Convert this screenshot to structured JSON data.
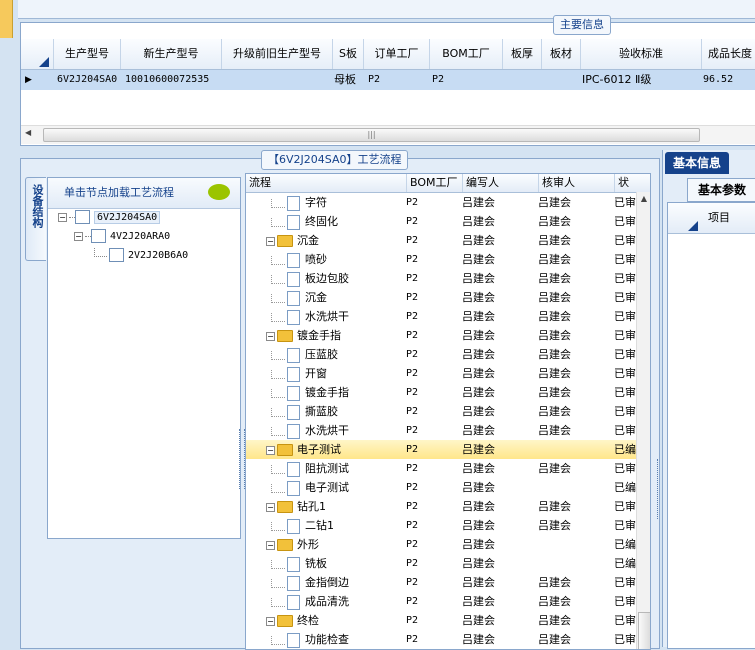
{
  "main_info": {
    "tab_label": "主要信息",
    "columns": [
      "生产型号",
      "新生产型号",
      "升级前旧生产型号",
      "S板",
      "订单工厂",
      "BOM工厂",
      "板厚",
      "板材",
      "验收标准",
      "成品长度"
    ],
    "row": {
      "production_model": "6V2J204SA0",
      "new_production_model": "10010600072535",
      "old_production_model": "",
      "s_board": "母板",
      "order_factory": "P2",
      "bom_factory": "P2",
      "thickness": "",
      "material": "",
      "acceptance_standard": "IPC-6012 Ⅱ级",
      "finished_length": "96.52"
    }
  },
  "process_panel": {
    "tab_label": "【6V2J204SA0】工艺流程",
    "side_tab_label": "设备结构",
    "tree_header": "单击节点加载工艺流程",
    "tree": [
      "6V2J204SA0",
      "4V2J20ARA0",
      "2V2J20B6A0"
    ],
    "grid": {
      "columns": [
        "流程",
        "BOM工厂",
        "编写人",
        "核审人",
        "状态"
      ],
      "rows": [
        {
          "name": "字符",
          "type": "step",
          "bom": "P2",
          "writer": "吕建会",
          "reviewer": "吕建会",
          "status": "已审"
        },
        {
          "name": "终固化",
          "type": "step",
          "bom": "P2",
          "writer": "吕建会",
          "reviewer": "吕建会",
          "status": "已审"
        },
        {
          "name": "沉金",
          "type": "group",
          "bom": "P2",
          "writer": "吕建会",
          "reviewer": "吕建会",
          "status": "已审"
        },
        {
          "name": "喷砂",
          "type": "step",
          "bom": "P2",
          "writer": "吕建会",
          "reviewer": "吕建会",
          "status": "已审"
        },
        {
          "name": "板边包胶",
          "type": "step",
          "bom": "P2",
          "writer": "吕建会",
          "reviewer": "吕建会",
          "status": "已审"
        },
        {
          "name": "沉金",
          "type": "step",
          "bom": "P2",
          "writer": "吕建会",
          "reviewer": "吕建会",
          "status": "已审"
        },
        {
          "name": "水洗烘干",
          "type": "step",
          "bom": "P2",
          "writer": "吕建会",
          "reviewer": "吕建会",
          "status": "已审"
        },
        {
          "name": "镀金手指",
          "type": "group",
          "bom": "P2",
          "writer": "吕建会",
          "reviewer": "吕建会",
          "status": "已审"
        },
        {
          "name": "压蓝胶",
          "type": "step",
          "bom": "P2",
          "writer": "吕建会",
          "reviewer": "吕建会",
          "status": "已审"
        },
        {
          "name": "开窗",
          "type": "step",
          "bom": "P2",
          "writer": "吕建会",
          "reviewer": "吕建会",
          "status": "已审"
        },
        {
          "name": "镀金手指",
          "type": "step",
          "bom": "P2",
          "writer": "吕建会",
          "reviewer": "吕建会",
          "status": "已审"
        },
        {
          "name": "撕蓝胶",
          "type": "step",
          "bom": "P2",
          "writer": "吕建会",
          "reviewer": "吕建会",
          "status": "已审"
        },
        {
          "name": "水洗烘干",
          "type": "step",
          "bom": "P2",
          "writer": "吕建会",
          "reviewer": "吕建会",
          "status": "已审"
        },
        {
          "name": "电子测试",
          "type": "group",
          "bom": "P2",
          "writer": "吕建会",
          "reviewer": "",
          "status": "已编",
          "selected": true
        },
        {
          "name": "阻抗测试",
          "type": "step",
          "bom": "P2",
          "writer": "吕建会",
          "reviewer": "吕建会",
          "status": "已审"
        },
        {
          "name": "电子测试",
          "type": "step",
          "bom": "P2",
          "writer": "吕建会",
          "reviewer": "",
          "status": "已编"
        },
        {
          "name": "钻孔1",
          "type": "group",
          "bom": "P2",
          "writer": "吕建会",
          "reviewer": "吕建会",
          "status": "已审"
        },
        {
          "name": "二钻1",
          "type": "step",
          "bom": "P2",
          "writer": "吕建会",
          "reviewer": "吕建会",
          "status": "已审"
        },
        {
          "name": "外形",
          "type": "group",
          "bom": "P2",
          "writer": "吕建会",
          "reviewer": "",
          "status": "已编"
        },
        {
          "name": "铣板",
          "type": "step",
          "bom": "P2",
          "writer": "吕建会",
          "reviewer": "",
          "status": "已编"
        },
        {
          "name": "金指倒边",
          "type": "step",
          "bom": "P2",
          "writer": "吕建会",
          "reviewer": "吕建会",
          "status": "已审"
        },
        {
          "name": "成品清洗",
          "type": "step",
          "bom": "P2",
          "writer": "吕建会",
          "reviewer": "吕建会",
          "status": "已审"
        },
        {
          "name": "终检",
          "type": "group",
          "bom": "P2",
          "writer": "吕建会",
          "reviewer": "吕建会",
          "status": "已审"
        },
        {
          "name": "功能检查",
          "type": "step",
          "bom": "P2",
          "writer": "吕建会",
          "reviewer": "吕建会",
          "status": "已审"
        }
      ]
    }
  },
  "info_panel": {
    "tab_label": "基本信息",
    "params_tab_label": "基本参数",
    "column_label": "项目"
  },
  "icons": {
    "row_pointer": "row-pointer-icon",
    "comment": "speech-bubble-icon",
    "folder": "folder-icon",
    "document": "document-icon"
  },
  "colors": {
    "accent": "#15428b",
    "selection": "#c7dcf3",
    "highlight": "#ffe68a",
    "comment_icon": "#9bc400"
  }
}
